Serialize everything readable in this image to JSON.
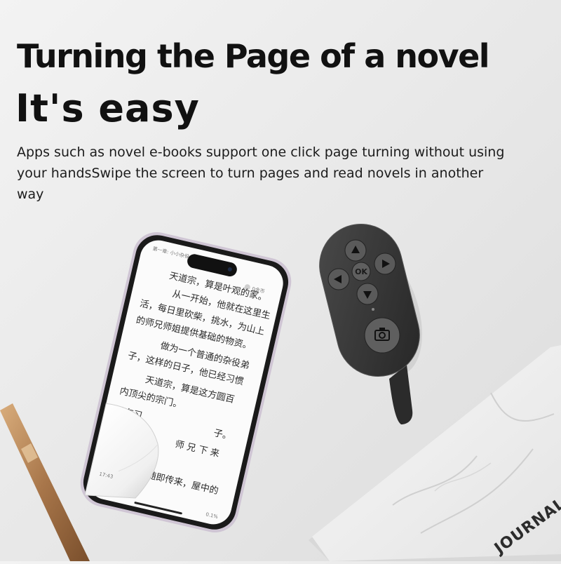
{
  "headline": "Turning the Page of a novel",
  "subheadline": "It's easy",
  "description": "Apps such as novel e-books support one click page turning without using your handsSwipe the screen to turn pages and read novels in another way",
  "phone": {
    "chapter_label": "第一章: 小小杂役",
    "badge_label": "0金币",
    "status_time": "17:43",
    "progress": "0.1%",
    "lines": [
      "天道宗，算是叶观的家。",
      "从一开始，他就在这里生",
      "活，每日里砍柴，挑水，为山上",
      "的师兄师姐提供基础的物资。",
      "做为一个普通的杂役弟",
      "子，这样的日子，他已经习惯",
      "天道宗，算是这方圆百",
      "内顶尖的宗门。",
      "没有习",
      "子。",
      "他天",
      "础的",
      "师 兄 下 来",
      "音随即传来，屋中的"
    ]
  },
  "remote": {
    "ok_label": "OK",
    "buttons": [
      "up-arrow-icon",
      "down-arrow-icon",
      "left-arrow-icon",
      "right-arrow-icon",
      "camera-icon"
    ]
  },
  "notebook": {
    "label": "JOURNAL"
  },
  "colors": {
    "background": "#ececec",
    "phone_frame": "#d9d0dc",
    "remote_body": "#3a3a3a",
    "pen_gold": "#b98a5a"
  }
}
